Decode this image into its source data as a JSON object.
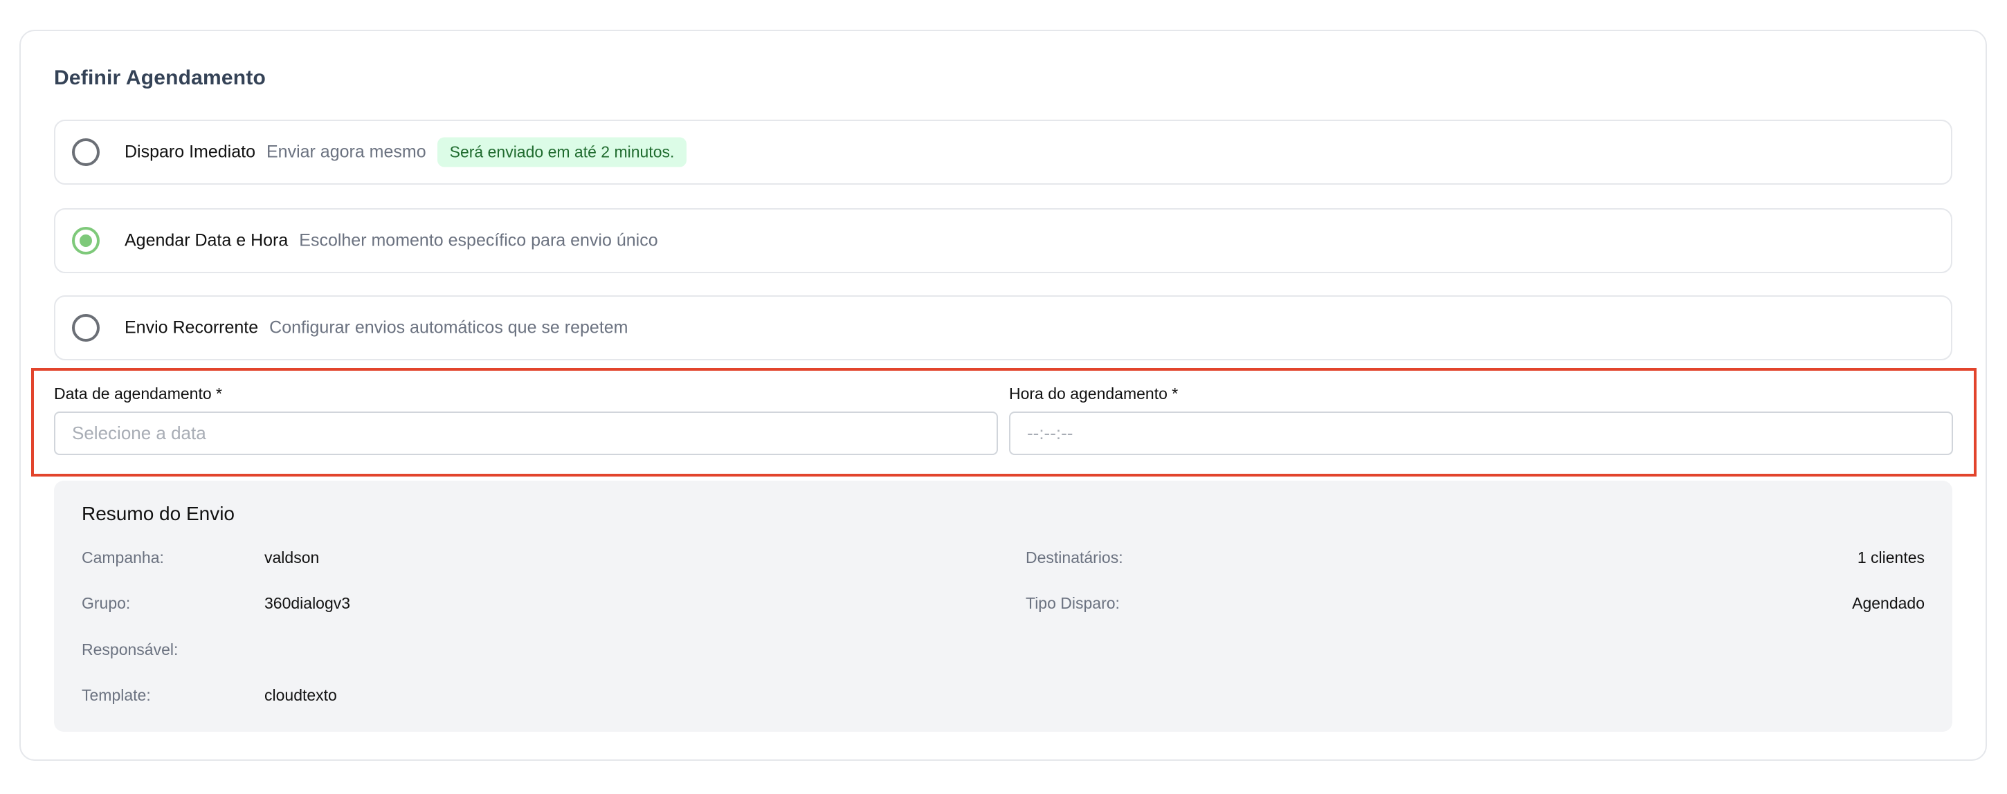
{
  "section": {
    "title": "Definir Agendamento"
  },
  "options": [
    {
      "title": "Disparo Imediato",
      "description": "Enviar agora mesmo",
      "badge": "Será enviado em até 2 minutos.",
      "selected": false
    },
    {
      "title": "Agendar Data e Hora",
      "description": "Escolher momento específico para envio único",
      "selected": true
    },
    {
      "title": "Envio Recorrente",
      "description": "Configurar envios automáticos que se repetem",
      "selected": false
    }
  ],
  "schedule": {
    "date_label": "Data de agendamento *",
    "date_placeholder": "Selecione a data",
    "date_value": "",
    "time_label": "Hora do agendamento *",
    "time_placeholder": "--:--:--",
    "time_value": ""
  },
  "summary": {
    "title": "Resumo do Envio",
    "campaign_label": "Campanha:",
    "campaign_value": "valdson",
    "group_label": "Grupo:",
    "group_value": "360dialogv3",
    "responsible_label": "Responsável:",
    "responsible_value": "",
    "template_label": "Template:",
    "template_value": "cloudtexto",
    "recipients_label": "Destinatários:",
    "recipients_value": "1 clientes",
    "dispatch_type_label": "Tipo Disparo:",
    "dispatch_type_value": "Agendado"
  },
  "colors": {
    "accent_green": "#7ec97a",
    "badge_bg": "#dcfce7",
    "badge_text": "#1f6b2e",
    "highlight_border": "#e2442c",
    "title_color": "#344256"
  }
}
